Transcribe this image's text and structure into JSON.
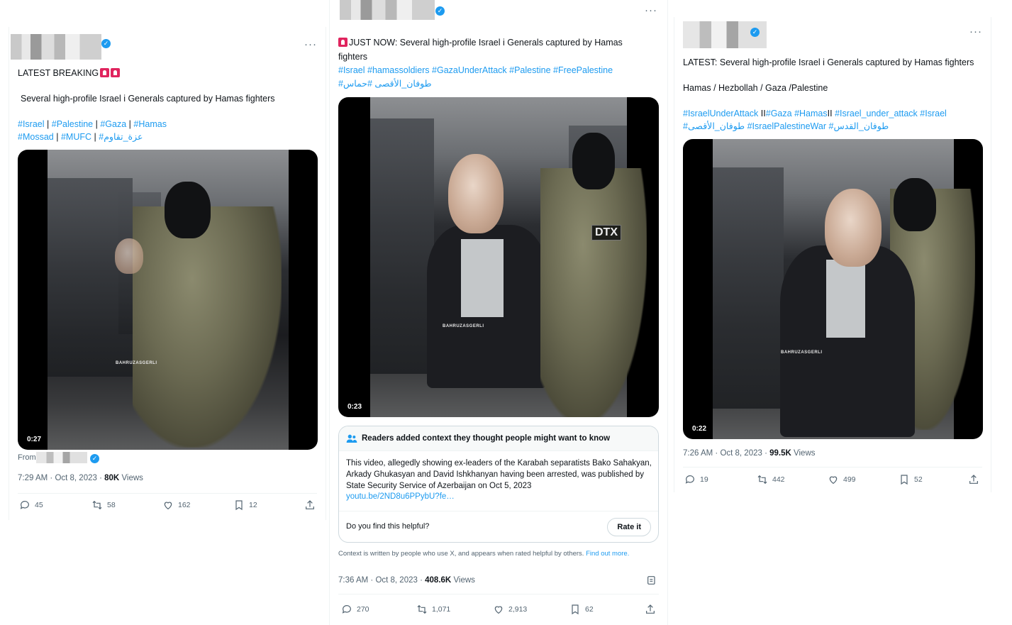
{
  "colors": {
    "accent": "#1d9bf0",
    "text": "#0f1419",
    "muted": "#536471",
    "border": "#eff3f4"
  },
  "tweets": [
    {
      "text_lines": [
        "LATEST BREAKING",
        "Several high-profile Israel i Generals captured by Hamas fighters"
      ],
      "hashtag_lines": [
        [
          "#Israel",
          "|",
          "#Palestine",
          "|",
          "#Gaza",
          "|",
          "#Hamas"
        ],
        [
          "#Mossad",
          "|",
          "#MUFC",
          "|",
          "#عزة_تقاوم"
        ]
      ],
      "video": {
        "duration": "0:27",
        "watermark": "BAHRUZASGERLI"
      },
      "from_label": "From",
      "meta": {
        "time": "7:29 AM",
        "date": "Oct 8, 2023",
        "views": "80K",
        "views_label": "Views"
      },
      "actions": {
        "replies": "45",
        "reposts": "58",
        "likes": "162",
        "bookmarks": "12"
      }
    },
    {
      "text_lines": [
        "JUST NOW: Several high-profile Israel i Generals captured by Hamas",
        "fighters"
      ],
      "hashtag_lines": [
        [
          "#Israel",
          "#hamassoldiers",
          "#GazaUnderAttack",
          "#Palestine",
          "#FreePalestine"
        ],
        [
          "#حماس",
          "#طوفان_الأقصى"
        ]
      ],
      "video": {
        "duration": "0:23",
        "watermark": "BAHRUZASGERLI",
        "badge": "DTX"
      },
      "note": {
        "title": "Readers added context they thought people might want to know",
        "body": "This video, allegedly showing ex-leaders of the Karabah separatists Bako Sahakyan, Arkady Ghukasyan and David Ishkhanyan having been arrested, was published by State Security Service of Azerbaijan on Oct 5, 2023",
        "link": "youtu.be/2ND8u6PPybU?fe…",
        "helpful_question": "Do you find this helpful?",
        "rate_label": "Rate it",
        "disclaimer": "Context is written by people who use X, and appears when rated helpful by others.",
        "find_out_more": "Find out more."
      },
      "meta": {
        "time": "7:36 AM",
        "date": "Oct 8, 2023",
        "views": "408.6K",
        "views_label": "Views"
      },
      "actions": {
        "replies": "270",
        "reposts": "1,071",
        "likes": "2,913",
        "bookmarks": "62"
      }
    },
    {
      "text_lines": [
        "LATEST: Several high-profile Israel i Generals captured by Hamas fighters",
        "Hamas / Hezbollah / Gaza /Palestine"
      ],
      "hashtag_lines": [
        [
          "#IsraelUnderAttack",
          "II",
          "#Gaza",
          "#Hamas",
          "II",
          "#Israel_under_attack",
          "#Israel"
        ],
        [
          "#طوفان_الأقصى",
          "#IsraelPalestineWar",
          "#طوفان_القدس"
        ]
      ],
      "video": {
        "duration": "0:22",
        "watermark": "BAHRUZASGERLI"
      },
      "meta": {
        "time": "7:26 AM",
        "date": "Oct 8, 2023",
        "views": "99.5K",
        "views_label": "Views"
      },
      "actions": {
        "replies": "19",
        "reposts": "442",
        "likes": "499",
        "bookmarks": "52"
      }
    }
  ]
}
